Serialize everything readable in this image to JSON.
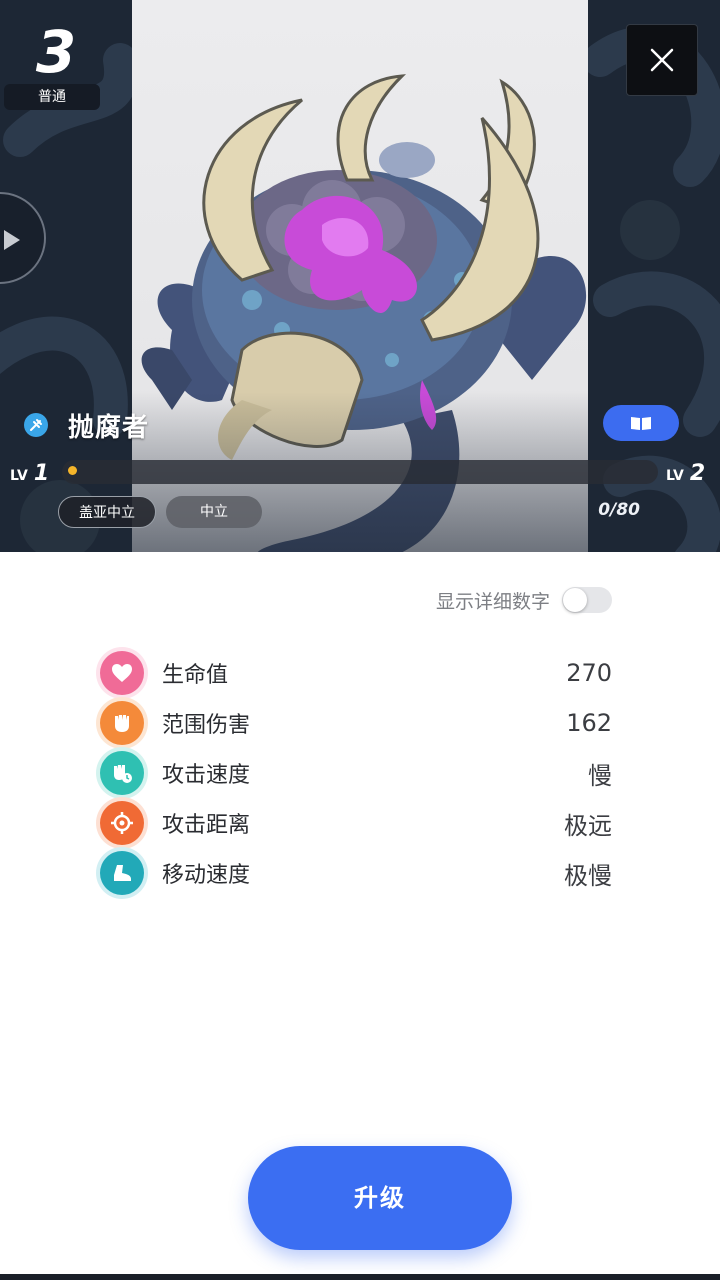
{
  "card": {
    "cost": "3",
    "rarity": "普通",
    "name": "抛腐者",
    "level_current_label": "LV",
    "level_current": "1",
    "level_next_label": "LV",
    "level_next": "2",
    "progress_fraction": 0.0,
    "xp_text": "0/80",
    "tags": [
      "盖亚中立",
      "中立"
    ]
  },
  "icons": {
    "close": "close-icon",
    "prev": "play-left-icon",
    "type": "syringe-icon",
    "book": "book-icon"
  },
  "details": {
    "label": "显示详细数字",
    "enabled": false
  },
  "stats": [
    {
      "icon": "heart-icon",
      "color": "#f06b97",
      "label": "生命值",
      "value": "270"
    },
    {
      "icon": "fist-icon",
      "color": "#f48a3a",
      "label": "范围伤害",
      "value": "162"
    },
    {
      "icon": "fist-clock-icon",
      "color": "#2fc0b2",
      "label": "攻击速度",
      "value": "慢"
    },
    {
      "icon": "target-icon",
      "color": "#f06a35",
      "label": "攻击距离",
      "value": "极远"
    },
    {
      "icon": "boot-icon",
      "color": "#22a9b8",
      "label": "移动速度",
      "value": "极慢"
    }
  ],
  "upgrade_label": "升级",
  "colors": {
    "accent": "#3b6ef2",
    "hero_bg": "#1d2735"
  }
}
